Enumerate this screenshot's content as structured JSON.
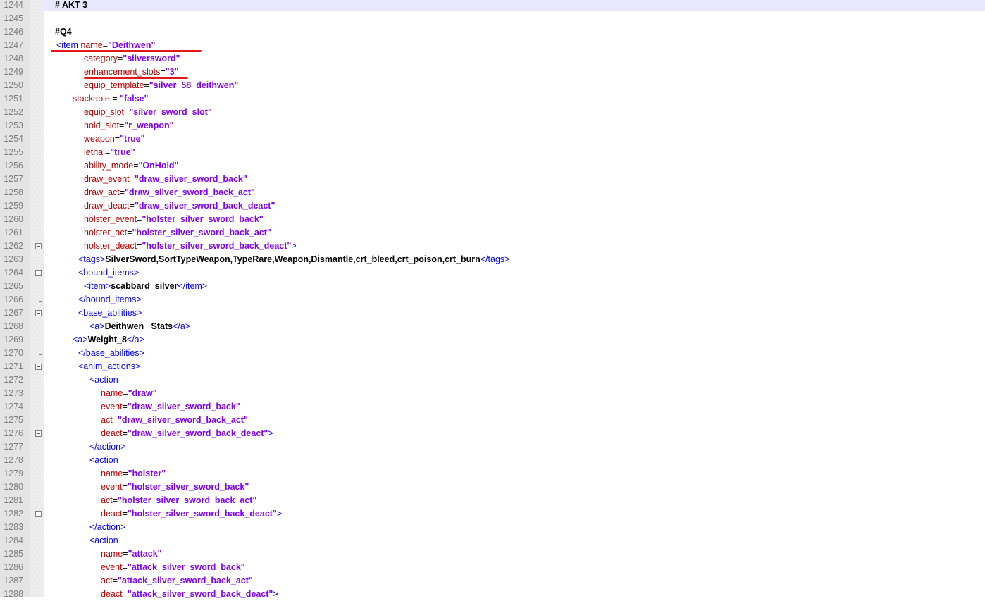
{
  "editor": {
    "lines": [
      {
        "n": "1244",
        "seg": [
          {
            "t": "text",
            "v": "# AKT 3"
          }
        ]
      },
      {
        "n": "1245",
        "seg": []
      },
      {
        "n": "1246",
        "seg": [
          {
            "t": "text",
            "v": "#Q4"
          }
        ]
      },
      {
        "n": "1247",
        "seg": [
          {
            "t": "tag",
            "v": "<item "
          },
          {
            "t": "attr",
            "v": "name"
          },
          {
            "t": "eq",
            "v": "="
          },
          {
            "t": "val",
            "v": "\"Deithwen\""
          }
        ]
      },
      {
        "n": "1248",
        "seg": [
          {
            "t": "attr",
            "v": "category"
          },
          {
            "t": "eq",
            "v": "="
          },
          {
            "t": "val",
            "v": "\"silversword\""
          }
        ]
      },
      {
        "n": "1249",
        "seg": [
          {
            "t": "attr",
            "v": "enhancement_slots"
          },
          {
            "t": "eq",
            "v": "="
          },
          {
            "t": "val",
            "v": "\"3\""
          }
        ]
      },
      {
        "n": "1250",
        "seg": [
          {
            "t": "attr",
            "v": "equip_template"
          },
          {
            "t": "eq",
            "v": "="
          },
          {
            "t": "val",
            "v": "\"silver_58_deithwen\""
          }
        ]
      },
      {
        "n": "1251",
        "seg": [
          {
            "t": "attr",
            "v": "stackable "
          },
          {
            "t": "eq",
            "v": "= "
          },
          {
            "t": "val",
            "v": "\"false\""
          }
        ]
      },
      {
        "n": "1252",
        "seg": [
          {
            "t": "attr",
            "v": "equip_slot"
          },
          {
            "t": "eq",
            "v": "="
          },
          {
            "t": "val",
            "v": "\"silver_sword_slot\""
          }
        ]
      },
      {
        "n": "1253",
        "seg": [
          {
            "t": "attr",
            "v": "hold_slot"
          },
          {
            "t": "eq",
            "v": "="
          },
          {
            "t": "val",
            "v": "\"r_weapon\""
          }
        ]
      },
      {
        "n": "1254",
        "seg": [
          {
            "t": "attr",
            "v": "weapon"
          },
          {
            "t": "eq",
            "v": "="
          },
          {
            "t": "val",
            "v": "\"true\""
          }
        ]
      },
      {
        "n": "1255",
        "seg": [
          {
            "t": "attr",
            "v": "lethal"
          },
          {
            "t": "eq",
            "v": "="
          },
          {
            "t": "val",
            "v": "\"true\""
          }
        ]
      },
      {
        "n": "1256",
        "seg": [
          {
            "t": "attr",
            "v": "ability_mode"
          },
          {
            "t": "eq",
            "v": "="
          },
          {
            "t": "val",
            "v": "\"OnHold\""
          }
        ]
      },
      {
        "n": "1257",
        "seg": [
          {
            "t": "attr",
            "v": "draw_event"
          },
          {
            "t": "eq",
            "v": "="
          },
          {
            "t": "val",
            "v": "\"draw_silver_sword_back\""
          }
        ]
      },
      {
        "n": "1258",
        "seg": [
          {
            "t": "attr",
            "v": "draw_act"
          },
          {
            "t": "eq",
            "v": "="
          },
          {
            "t": "val",
            "v": "\"draw_silver_sword_back_act\""
          }
        ]
      },
      {
        "n": "1259",
        "seg": [
          {
            "t": "attr",
            "v": "draw_deact"
          },
          {
            "t": "eq",
            "v": "="
          },
          {
            "t": "val",
            "v": "\"draw_silver_sword_back_deact\""
          }
        ]
      },
      {
        "n": "1260",
        "seg": [
          {
            "t": "attr",
            "v": "holster_event"
          },
          {
            "t": "eq",
            "v": "="
          },
          {
            "t": "val",
            "v": "\"holster_silver_sword_back\""
          }
        ]
      },
      {
        "n": "1261",
        "seg": [
          {
            "t": "attr",
            "v": "holster_act"
          },
          {
            "t": "eq",
            "v": "="
          },
          {
            "t": "val",
            "v": "\"holster_silver_sword_back_act\""
          }
        ]
      },
      {
        "n": "1262",
        "seg": [
          {
            "t": "attr",
            "v": "holster_deact"
          },
          {
            "t": "eq",
            "v": "="
          },
          {
            "t": "val",
            "v": "\"holster_silver_sword_back_deact\""
          },
          {
            "t": "tag",
            "v": ">"
          }
        ]
      },
      {
        "n": "1263",
        "seg": [
          {
            "t": "tag",
            "v": "<tags>"
          },
          {
            "t": "text",
            "v": "SilverSword,SortTypeWeapon,TypeRare,Weapon,Dismantle,crt_bleed,crt_poison,crt_burn"
          },
          {
            "t": "tag",
            "v": "</tags>"
          }
        ]
      },
      {
        "n": "1264",
        "seg": [
          {
            "t": "tag",
            "v": "<bound_items>"
          }
        ]
      },
      {
        "n": "1265",
        "seg": [
          {
            "t": "tag",
            "v": "<item>"
          },
          {
            "t": "text",
            "v": "scabbard_silver"
          },
          {
            "t": "tag",
            "v": "</item>"
          }
        ]
      },
      {
        "n": "1266",
        "seg": [
          {
            "t": "tag",
            "v": "</bound_items>"
          }
        ]
      },
      {
        "n": "1267",
        "seg": [
          {
            "t": "tag",
            "v": "<base_abilities>"
          }
        ]
      },
      {
        "n": "1268",
        "seg": [
          {
            "t": "tag",
            "v": "<a>"
          },
          {
            "t": "text",
            "v": "Deithwen _Stats"
          },
          {
            "t": "tag",
            "v": "</a>"
          }
        ]
      },
      {
        "n": "1269",
        "seg": [
          {
            "t": "tag",
            "v": "<a>"
          },
          {
            "t": "text",
            "v": "Weight_8"
          },
          {
            "t": "tag",
            "v": "</a>"
          }
        ]
      },
      {
        "n": "1270",
        "seg": [
          {
            "t": "tag",
            "v": "</base_abilities>"
          }
        ]
      },
      {
        "n": "1271",
        "seg": [
          {
            "t": "tag",
            "v": "<anim_actions>"
          }
        ]
      },
      {
        "n": "1272",
        "seg": [
          {
            "t": "tag",
            "v": "<action"
          }
        ]
      },
      {
        "n": "1273",
        "seg": [
          {
            "t": "attr",
            "v": "name"
          },
          {
            "t": "eq",
            "v": "="
          },
          {
            "t": "val",
            "v": "\"draw\""
          }
        ]
      },
      {
        "n": "1274",
        "seg": [
          {
            "t": "attr",
            "v": "event"
          },
          {
            "t": "eq",
            "v": "="
          },
          {
            "t": "val",
            "v": "\"draw_silver_sword_back\""
          }
        ]
      },
      {
        "n": "1275",
        "seg": [
          {
            "t": "attr",
            "v": "act"
          },
          {
            "t": "eq",
            "v": "="
          },
          {
            "t": "val",
            "v": "\"draw_silver_sword_back_act\""
          }
        ]
      },
      {
        "n": "1276",
        "seg": [
          {
            "t": "attr",
            "v": "deact"
          },
          {
            "t": "eq",
            "v": "="
          },
          {
            "t": "val",
            "v": "\"draw_silver_sword_back_deact\""
          },
          {
            "t": "tag",
            "v": ">"
          }
        ]
      },
      {
        "n": "1277",
        "seg": [
          {
            "t": "tag",
            "v": "</action>"
          }
        ]
      },
      {
        "n": "1278",
        "seg": [
          {
            "t": "tag",
            "v": "<action"
          }
        ]
      },
      {
        "n": "1279",
        "seg": [
          {
            "t": "attr",
            "v": "name"
          },
          {
            "t": "eq",
            "v": "="
          },
          {
            "t": "val",
            "v": "\"holster\""
          }
        ]
      },
      {
        "n": "1280",
        "seg": [
          {
            "t": "attr",
            "v": "event"
          },
          {
            "t": "eq",
            "v": "="
          },
          {
            "t": "val",
            "v": "\"holster_silver_sword_back\""
          }
        ]
      },
      {
        "n": "1281",
        "seg": [
          {
            "t": "attr",
            "v": "act"
          },
          {
            "t": "eq",
            "v": "="
          },
          {
            "t": "val",
            "v": "\"holster_silver_sword_back_act\""
          }
        ]
      },
      {
        "n": "1282",
        "seg": [
          {
            "t": "attr",
            "v": "deact"
          },
          {
            "t": "eq",
            "v": "="
          },
          {
            "t": "val",
            "v": "\"holster_silver_sword_back_deact\""
          },
          {
            "t": "tag",
            "v": ">"
          }
        ]
      },
      {
        "n": "1283",
        "seg": [
          {
            "t": "tag",
            "v": "</action>"
          }
        ]
      },
      {
        "n": "1284",
        "seg": [
          {
            "t": "tag",
            "v": "<action"
          }
        ]
      },
      {
        "n": "1285",
        "seg": [
          {
            "t": "attr",
            "v": "name"
          },
          {
            "t": "eq",
            "v": "="
          },
          {
            "t": "val",
            "v": "\"attack\""
          }
        ]
      },
      {
        "n": "1286",
        "seg": [
          {
            "t": "attr",
            "v": "event"
          },
          {
            "t": "eq",
            "v": "="
          },
          {
            "t": "val",
            "v": "\"attack_silver_sword_back\""
          }
        ]
      },
      {
        "n": "1287",
        "seg": [
          {
            "t": "attr",
            "v": "act"
          },
          {
            "t": "eq",
            "v": "="
          },
          {
            "t": "val",
            "v": "\"attack_silver_sword_back_act\""
          }
        ]
      },
      {
        "n": "1288",
        "seg": [
          {
            "t": "attr",
            "v": "deact"
          },
          {
            "t": "eq",
            "v": "="
          },
          {
            "t": "val",
            "v": "\"attack_silver_sword_back_deact\""
          },
          {
            "t": "tag",
            "v": ">"
          }
        ]
      }
    ]
  }
}
